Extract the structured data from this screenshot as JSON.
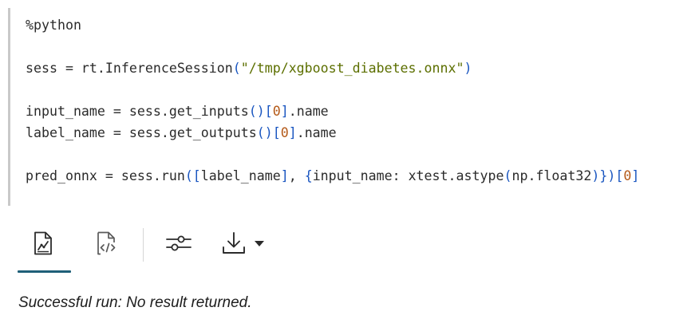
{
  "code": {
    "magic": "%python",
    "line_sess_prefix": "sess = rt.InferenceSession",
    "line_sess_path": "\"/tmp/xgboost_diabetes.onnx\"",
    "line_input_prefix": "input_name = sess.get_inputs",
    "line_input_index": "0",
    "line_input_suffix": ".name",
    "line_label_prefix": "label_name = sess.get_outputs",
    "line_label_index": "0",
    "line_label_suffix": ".name",
    "line_pred_prefix": "pred_onnx = sess.run",
    "line_pred_list_item": "label_name",
    "line_pred_dict_body": "input_name: xtest.astype",
    "line_pred_dtype": "np.float32",
    "line_pred_index": "0"
  },
  "toolbar": {
    "icons": [
      "chart-result-icon",
      "code-result-icon",
      "settings-sliders-icon",
      "download-icon",
      "caret-down-icon"
    ],
    "accent_color": "#1f5f78"
  },
  "status": {
    "message": "Successful run: No result returned."
  }
}
